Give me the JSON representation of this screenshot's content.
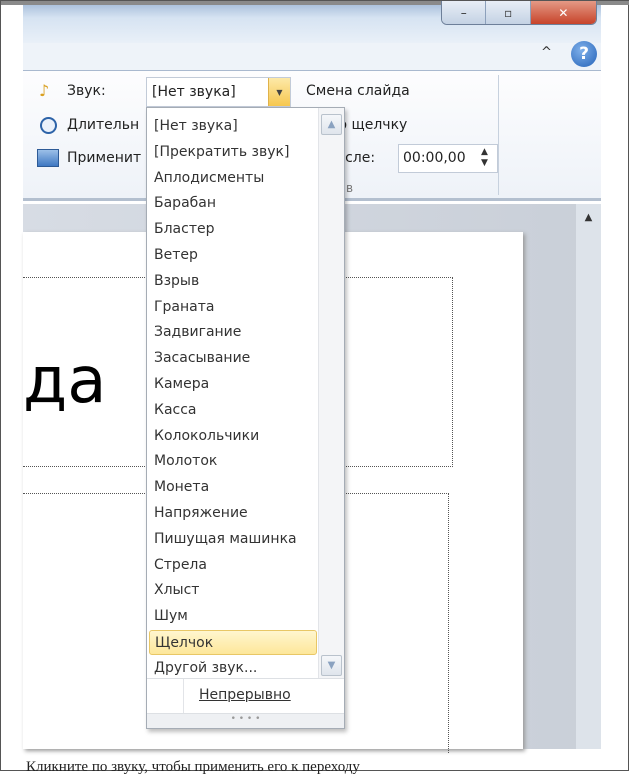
{
  "window": {
    "minimize": "–",
    "maximize": "▫",
    "close": "✕",
    "collapse_ribbon": "^",
    "help": "?"
  },
  "ribbon": {
    "sound_label": "Звук:",
    "sound_value": "[Нет звука]",
    "duration_label": "Длительн",
    "apply_label": "Применит",
    "advance_title": "Смена слайда",
    "on_click_label": "По щелчку",
    "after_label": "После:",
    "after_value": "00:00,00",
    "group_label_fragment": "в"
  },
  "slide": {
    "title_fragment": "да"
  },
  "dropdown": {
    "items": [
      "[Нет звука]",
      "[Прекратить звук]",
      "Аплодисменты",
      "Барабан",
      "Бластер",
      "Ветер",
      "Взрыв",
      "Граната",
      "Задвигание",
      "Засасывание",
      "Камера",
      "Касса",
      "Колокольчики",
      "Молоток",
      "Монета",
      "Напряжение",
      "Пишущая машинка",
      "Стрела",
      "Хлыст",
      "Шум",
      "Щелчок",
      "Другой звук..."
    ],
    "selected": "Щелчок",
    "loop_label": "Непрерывно"
  },
  "caption": "Кликните по звуку, чтобы применить его к переходу"
}
